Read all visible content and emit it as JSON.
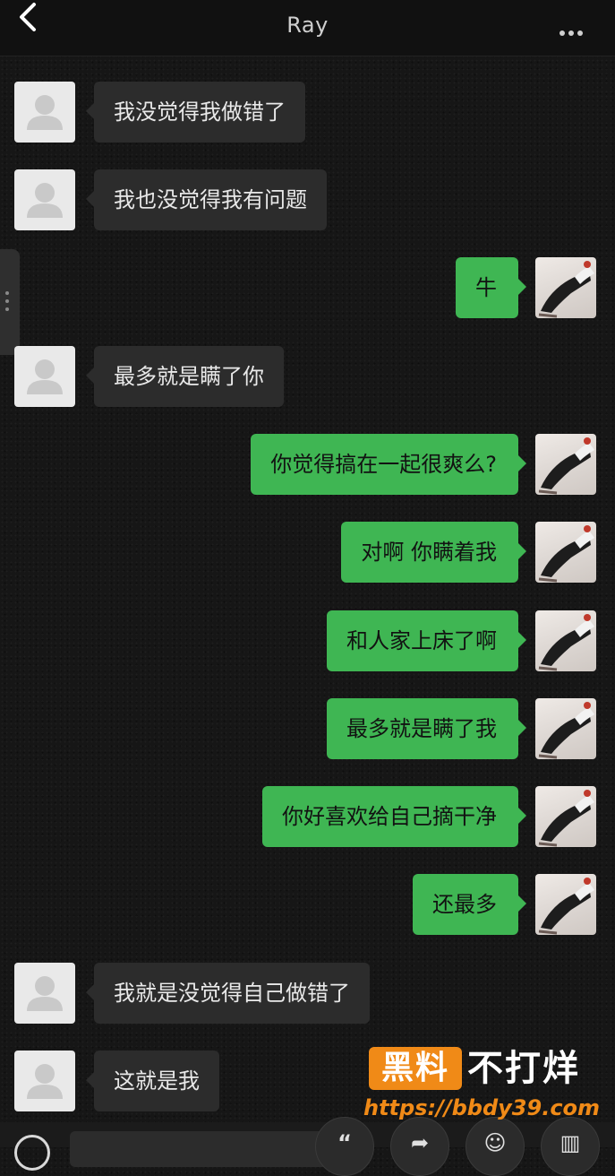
{
  "header": {
    "title": "Ray"
  },
  "messages": [
    {
      "side": "in",
      "text": "我没觉得我做错了"
    },
    {
      "side": "in",
      "text": "我也没觉得我有问题"
    },
    {
      "side": "out",
      "text": "牛"
    },
    {
      "side": "in",
      "text": "最多就是瞒了你"
    },
    {
      "side": "out",
      "text": "你觉得搞在一起很爽么?"
    },
    {
      "side": "out",
      "text": "对啊 你瞒着我"
    },
    {
      "side": "out",
      "text": "和人家上床了啊"
    },
    {
      "side": "out",
      "text": "最多就是瞒了我"
    },
    {
      "side": "out",
      "text": "你好喜欢给自己摘干净"
    },
    {
      "side": "out",
      "text": "还最多"
    },
    {
      "side": "in",
      "text": "我就是没觉得自己做错了"
    },
    {
      "side": "in",
      "text": "这就是我"
    }
  ],
  "watermark": {
    "brand": "黑料",
    "tagline": "不打烊",
    "url": "https://bbdy39.com"
  },
  "colors": {
    "outgoing_bubble": "#3fb653",
    "incoming_bubble": "#2c2c2c",
    "watermark": "#f08a17"
  },
  "icons": {
    "back": "chevron-left-icon",
    "more": "more-dots-icon",
    "incoming_avatar": "default-user-avatar",
    "outgoing_avatar": "photo-avatar"
  }
}
